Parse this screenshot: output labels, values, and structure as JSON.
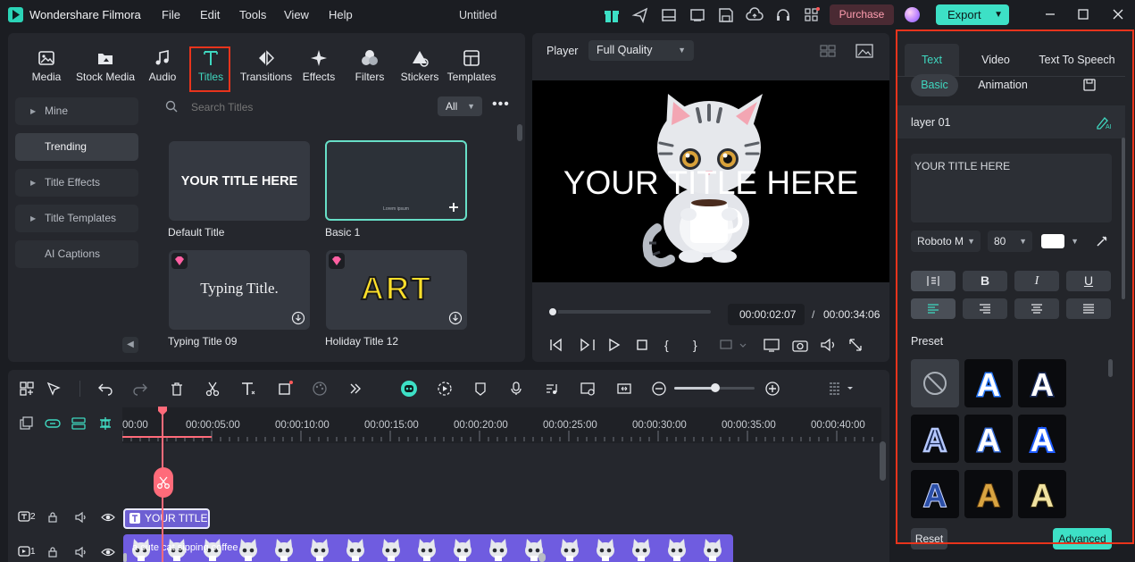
{
  "app": {
    "name": "Wondershare Filmora",
    "menus": [
      "File",
      "Edit",
      "Tools",
      "View",
      "Help"
    ],
    "doc_title": "Untitled",
    "purchase_label": "Purchase",
    "export_label": "Export",
    "accent_color": "#3fd8c0",
    "highlight_color": "#e8341c"
  },
  "library": {
    "tabs": [
      {
        "label": "Media",
        "icon": "media-icon"
      },
      {
        "label": "Stock Media",
        "icon": "stock-media-icon"
      },
      {
        "label": "Audio",
        "icon": "music-note-icon"
      },
      {
        "label": "Titles",
        "icon": "titles-t-icon",
        "active": true
      },
      {
        "label": "Transitions",
        "icon": "transitions-icon"
      },
      {
        "label": "Effects",
        "icon": "effects-sparkle-icon"
      },
      {
        "label": "Filters",
        "icon": "filters-icon"
      },
      {
        "label": "Stickers",
        "icon": "stickers-icon"
      },
      {
        "label": "Templates",
        "icon": "templates-icon"
      }
    ],
    "sidebar": [
      {
        "label": "Mine",
        "caret": true
      },
      {
        "label": "Trending",
        "active": true
      },
      {
        "label": "Title Effects",
        "caret": true
      },
      {
        "label": "Title Templates",
        "caret": true
      },
      {
        "label": "AI Captions"
      }
    ],
    "search_placeholder": "Search Titles",
    "filter_value": "All",
    "cards": [
      {
        "caption": "Default Title",
        "thumb_text": "YOUR TITLE HERE"
      },
      {
        "caption": "Basic 1",
        "thumb_text": "Lorem ipsum",
        "selected": true
      },
      {
        "caption": "Typing Title 09",
        "thumb_text": "Typing Title.",
        "premium": true
      },
      {
        "caption": "Holiday Title 12",
        "thumb_text": "ART",
        "premium": true
      }
    ]
  },
  "player": {
    "label": "Player",
    "quality": "Full Quality",
    "preview_title": "YOUR TITLE HERE",
    "progress": 0.02,
    "current_time": "00:00:02:07",
    "separator": "/",
    "total_time": "00:00:34:06"
  },
  "props": {
    "tabs": [
      "Text",
      "Video",
      "Text To Speech"
    ],
    "subtabs": [
      "Basic",
      "Animation"
    ],
    "layer_name": "layer 01",
    "text_value": "YOUR TITLE HERE",
    "font": "Roboto M",
    "size": "80",
    "text_color": "#ffffff",
    "format_bold": "B",
    "format_italic": "I",
    "format_underline": "U",
    "preset_label": "Preset",
    "reset_label": "Reset",
    "advanced_label": "Advanced"
  },
  "timeline": {
    "ruler_labels": [
      "00:00",
      "00:00:05:00",
      "00:00:10:00",
      "00:00:15:00",
      "00:00:20:00",
      "00:00:25:00",
      "00:00:30:00",
      "00:00:35:00",
      "00:00:40:00"
    ],
    "title_track_number": "2",
    "video_track_number": "1",
    "title_clip_label": "YOUR TITLE...",
    "video_clip_label": "a cute cat sipping coffee"
  }
}
